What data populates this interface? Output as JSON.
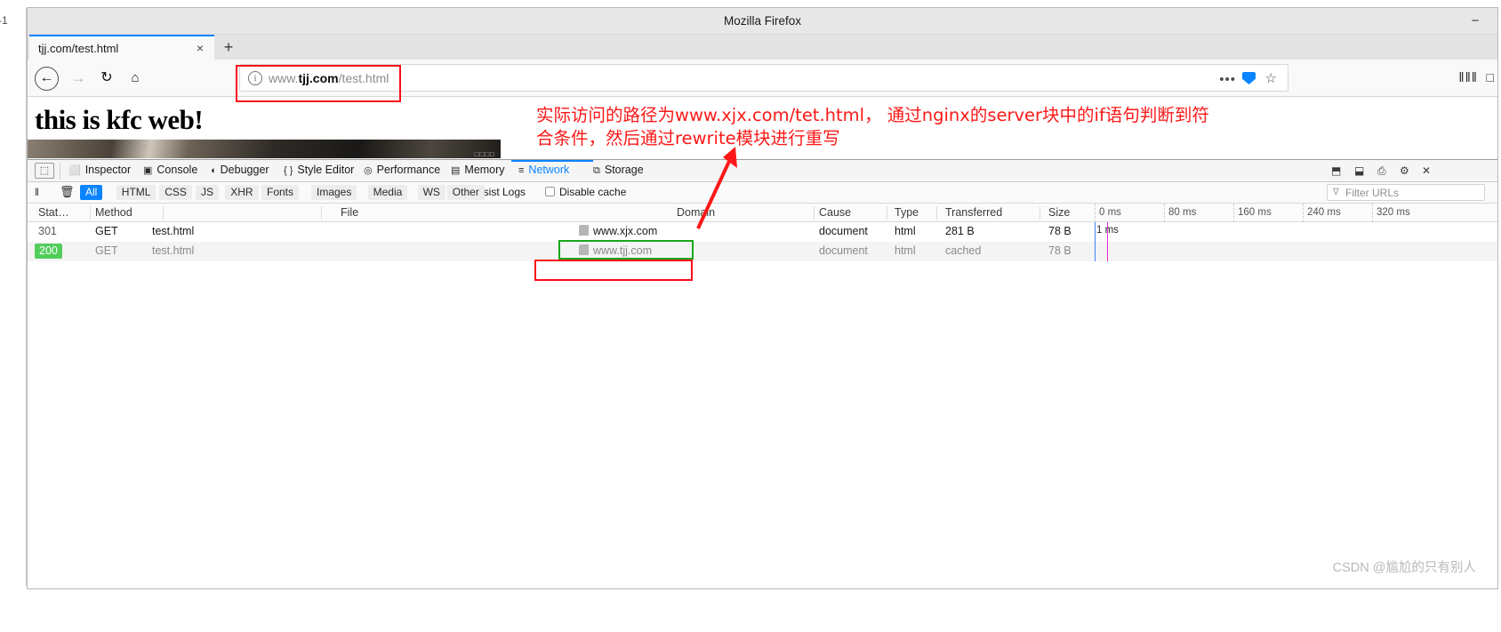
{
  "gutter": {
    "label": "-1"
  },
  "window": {
    "title": "Mozilla Firefox",
    "minimize_label": "−"
  },
  "tabstrip": {
    "tab_label": "tjj.com/test.html",
    "close_label": "×",
    "new_tab_label": "+"
  },
  "navbar": {
    "back_icon": "←",
    "forward_icon": "→",
    "reload_icon": "↻",
    "home_icon": "⌂",
    "info_icon": "i",
    "url_prefix": "www.",
    "url_domain": "tjj.com",
    "url_path": "/test.html",
    "dots_icon": "•••",
    "star_icon": "☆",
    "library_icon": "‖‖‖",
    "sidebar_icon": "□"
  },
  "page": {
    "heading": "this is kfc web!",
    "photo_caption": "□□□□"
  },
  "devtools": {
    "picker_icon": "⬚",
    "tabs": [
      {
        "label": "Inspector",
        "icon": "⬜",
        "active": false
      },
      {
        "label": "Console",
        "icon": "▣",
        "active": false
      },
      {
        "label": "Debugger",
        "icon": "◖",
        "active": false
      },
      {
        "label": "Style Editor",
        "icon": "{ }",
        "active": false
      },
      {
        "label": "Performance",
        "icon": "◎",
        "active": false
      },
      {
        "label": "Memory",
        "icon": "▤",
        "active": false
      },
      {
        "label": "Network",
        "icon": "≡",
        "active": true
      },
      {
        "label": "Storage",
        "icon": "⧉",
        "active": false
      }
    ],
    "right_icons": [
      {
        "name": "layout-bottom-icon",
        "glyph": "⬒"
      },
      {
        "name": "layout-side-icon",
        "glyph": "⬓"
      },
      {
        "name": "screenshot-icon",
        "glyph": "⎙"
      },
      {
        "name": "settings-icon",
        "glyph": "⚙"
      },
      {
        "name": "close-devtools-icon",
        "glyph": "✕"
      }
    ]
  },
  "network_toolbar": {
    "pause_icon": "‖",
    "clear_icon": "🗑",
    "filters": [
      {
        "label": "All",
        "active": true
      },
      {
        "label": "HTML",
        "active": false
      },
      {
        "label": "CSS",
        "active": false
      },
      {
        "label": "JS",
        "active": false
      },
      {
        "label": "XHR",
        "active": false
      },
      {
        "label": "Fonts",
        "active": false
      },
      {
        "label": "Images",
        "active": false
      },
      {
        "label": "Media",
        "active": false
      },
      {
        "label": "WS",
        "active": false
      },
      {
        "label": "Other",
        "active": false
      }
    ],
    "persist_logs_label": "Persist Logs",
    "disable_cache_label": "Disable cache",
    "filter_urls_placeholder": "Filter URLs",
    "filter_urls_icon": "∇"
  },
  "network_table": {
    "columns": [
      "Stat…",
      "Method",
      "File",
      "Domain",
      "Cause",
      "Type",
      "Transferred",
      "Size"
    ],
    "rows": [
      {
        "status": "301",
        "method": "GET",
        "file": "test.html",
        "domain": "www.xjx.com",
        "cause": "document",
        "type": "html",
        "transferred": "281 B",
        "size": "78 B",
        "timing": "1 ms"
      },
      {
        "status": "200",
        "method": "GET",
        "file": "test.html",
        "domain": "www.tjj.com",
        "cause": "document",
        "type": "html",
        "transferred": "cached",
        "size": "78 B",
        "timing": ""
      }
    ],
    "timeline_ticks": [
      "0 ms",
      "80 ms",
      "160 ms",
      "240 ms",
      "320 ms"
    ]
  },
  "annotation": {
    "line1": "实际访问的路径为www.xjx.com/tet.html， 通过nginx的server块中的if语句判断到符",
    "line2": "合条件，然后通过rewrite模块进行重写"
  },
  "watermark": {
    "text": "CSDN @尴尬的只有别人"
  },
  "colors": {
    "accent_blue": "#0a84ff",
    "status_ok_green": "#51cd5b",
    "annotation_red": "#fc1818",
    "highlight_green": "#17a81a"
  }
}
